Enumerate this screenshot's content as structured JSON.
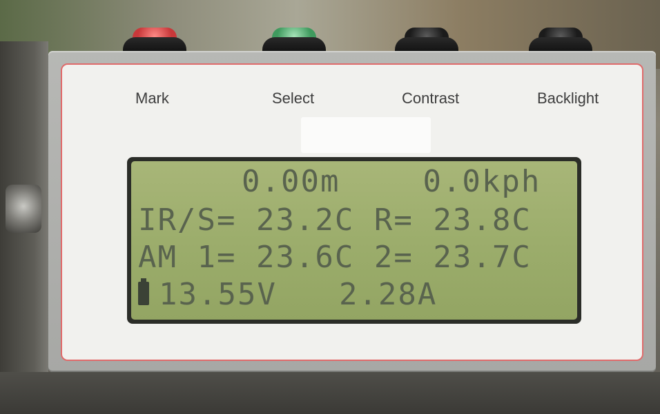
{
  "buttons": [
    {
      "label": "Mark",
      "cap_color": "#c8383a"
    },
    {
      "label": "Select",
      "cap_color": "#3f9a5e"
    },
    {
      "label": "Contrast",
      "cap_color": "#1b1b1b"
    },
    {
      "label": "Backlight",
      "cap_color": "#1b1b1b"
    }
  ],
  "lcd": {
    "line1": {
      "distance": "0.00m",
      "speed": "0.0kph"
    },
    "line2": {
      "label": "IR/S=",
      "ir_temp": "23.2C",
      "r_label": "R=",
      "r_temp": "23.8C"
    },
    "line3": {
      "label": "AM 1=",
      "am1_temp": "23.6C",
      "am2_label": "2=",
      "am2_temp": "23.7C"
    },
    "line4": {
      "icon": "battery-icon",
      "voltage": "13.55V",
      "current": "2.28A"
    }
  },
  "colors": {
    "lcd_background": "#9cad6c",
    "lcd_text": "#59634e",
    "faceplate_border": "#e06a6a"
  }
}
